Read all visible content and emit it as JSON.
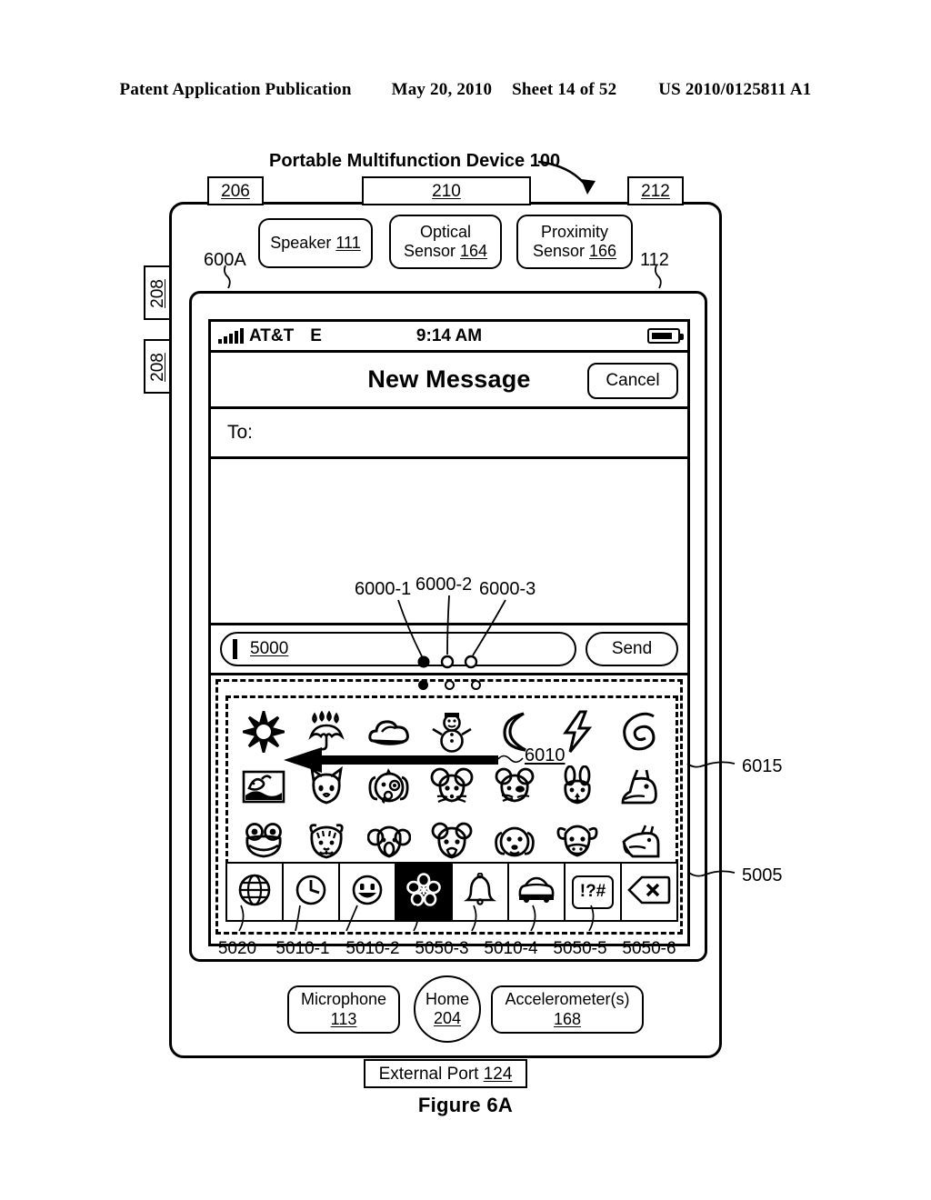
{
  "publication": {
    "left": "Patent Application Publication",
    "date": "May 20, 2010",
    "sheet": "Sheet 14 of 52",
    "number": "US 2010/0125811 A1"
  },
  "figure": {
    "caption": "Figure 6A"
  },
  "device": {
    "title": "Portable Multifunction Device 100",
    "title_ref": "100",
    "top_tabs": [
      {
        "ref": "206",
        "name": "tab-206"
      },
      {
        "ref": "210",
        "name": "tab-210"
      },
      {
        "ref": "212",
        "name": "tab-212"
      }
    ],
    "side_tabs": [
      {
        "ref": "208"
      },
      {
        "ref": "208"
      }
    ],
    "sensors": {
      "speaker_label": "Speaker",
      "speaker_ref": "111",
      "optical_line1": "Optical",
      "optical_line2": "Sensor",
      "optical_ref": "164",
      "proximity_line1": "Proximity",
      "proximity_line2": "Sensor",
      "proximity_ref": "166"
    },
    "bottom": {
      "microphone_label": "Microphone",
      "microphone_ref": "113",
      "home_label": "Home",
      "home_ref": "204",
      "accelerometer_label": "Accelerometer(s)",
      "accelerometer_ref": "168",
      "external_port_label": "External Port",
      "external_port_ref": "124"
    },
    "callouts": {
      "screen_ui": "600A",
      "touch_screen": "112"
    }
  },
  "screen": {
    "status_bar": {
      "signal_icon": "signal-bars-icon",
      "carrier": "AT&T",
      "network": "E",
      "time": "9:14 AM",
      "battery_icon": "battery-icon"
    },
    "nav_bar": {
      "title": "New Message",
      "cancel_label": "Cancel"
    },
    "to_row": {
      "label": "To:"
    },
    "compose": {
      "field_ref": "5000",
      "placeholder": "",
      "value": "",
      "send_label": "Send"
    },
    "page_dots": {
      "count": 3,
      "active_index": 0,
      "refs": [
        "6000-1",
        "6000-2",
        "6000-3"
      ]
    },
    "keyboard": {
      "region_ref": "5005",
      "palette_ref": "6015",
      "swipe_gesture_ref": "6010",
      "rows": [
        [
          {
            "name": "sun-icon",
            "label": "sun"
          },
          {
            "name": "umbrella-rain-icon",
            "label": "umbrella with rain"
          },
          {
            "name": "cloud-icon",
            "label": "cloud"
          },
          {
            "name": "snowman-icon",
            "label": "snowman"
          },
          {
            "name": "crescent-moon-icon",
            "label": "crescent moon"
          },
          {
            "name": "lightning-bolt-icon",
            "label": "lightning bolt"
          },
          {
            "name": "cyclone-icon",
            "label": "cyclone spiral"
          }
        ],
        [
          {
            "name": "whale-icon",
            "label": "whale"
          },
          {
            "name": "cat-face-icon",
            "label": "cat face"
          },
          {
            "name": "dog-face-icon",
            "label": "dog face"
          },
          {
            "name": "mouse-face-icon",
            "label": "mouse face"
          },
          {
            "name": "hamster-face-icon",
            "label": "hamster face"
          },
          {
            "name": "rabbit-face-icon",
            "label": "rabbit face"
          },
          {
            "name": "horse-head-icon",
            "label": "horse head"
          }
        ],
        [
          {
            "name": "frog-face-icon",
            "label": "frog face"
          },
          {
            "name": "tiger-face-icon",
            "label": "tiger face"
          },
          {
            "name": "koala-face-icon",
            "label": "koala face"
          },
          {
            "name": "bear-face-icon",
            "label": "bear face"
          },
          {
            "name": "puppy-face-icon",
            "label": "puppy face"
          },
          {
            "name": "cow-face-icon",
            "label": "cow face"
          },
          {
            "name": "boar-icon",
            "label": "boar"
          }
        ]
      ],
      "tabs": [
        {
          "name": "globe-icon",
          "ref": "5020",
          "selected": false
        },
        {
          "name": "clock-icon",
          "ref": "5010-1",
          "selected": false
        },
        {
          "name": "smiley-icon",
          "ref": "5010-2",
          "selected": false
        },
        {
          "name": "flower-icon",
          "ref": "5050-3",
          "selected": true
        },
        {
          "name": "bell-icon",
          "ref": "5010-4",
          "selected": false
        },
        {
          "name": "car-icon",
          "ref": "5050-5",
          "selected": false
        },
        {
          "name": "symbols-icon",
          "ref": "5050-6",
          "selected": false,
          "glyph": "!?#"
        },
        {
          "name": "delete-icon",
          "ref": "",
          "selected": false
        }
      ],
      "tab_refs": [
        "5020",
        "5010-1",
        "5010-2",
        "5050-3",
        "5010-4",
        "5050-5",
        "5050-6"
      ]
    }
  }
}
